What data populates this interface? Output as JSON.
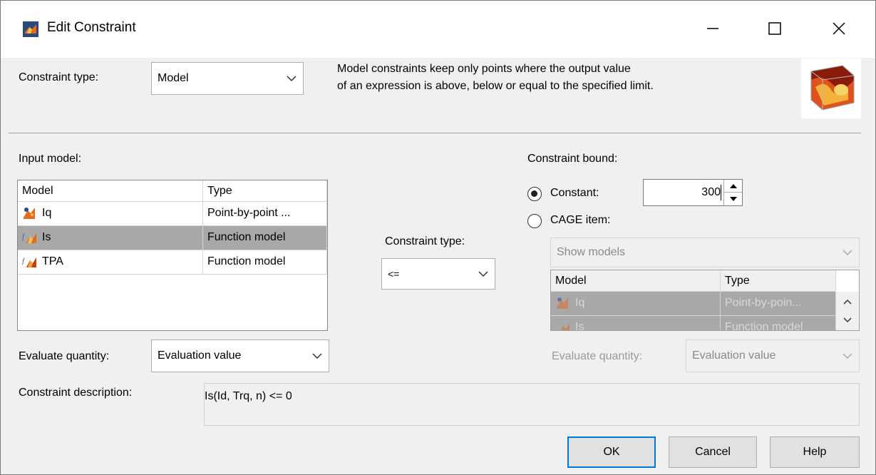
{
  "window": {
    "title": "Edit Constraint"
  },
  "header": {
    "constraint_type_label": "Constraint type:",
    "constraint_type_value": "Model",
    "description_line1": "Model constraints keep only points where the output value",
    "description_line2": "of an expression is above, below or equal to the specified limit."
  },
  "input_model": {
    "label": "Input model:",
    "columns": [
      "Model",
      "Type"
    ],
    "rows": [
      {
        "model": "Iq",
        "type": "Point-by-point ...",
        "icon": "point-by-point-model-icon"
      },
      {
        "model": "Is",
        "type": "Function model",
        "icon": "function-model-icon"
      },
      {
        "model": "TPA",
        "type": "Function model",
        "icon": "function-model-icon"
      }
    ],
    "selected_row": 1
  },
  "operator": {
    "label": "Constraint type:",
    "value": "<="
  },
  "bound": {
    "label": "Constraint bound:",
    "constant_label": "Constant:",
    "constant_value": "300",
    "constant_selected": true,
    "cage_label": "CAGE item:",
    "show_models_value": "Show models",
    "columns": [
      "Model",
      "Type"
    ],
    "rows": [
      {
        "model": "Iq",
        "type": "Point-by-poin..."
      },
      {
        "model": "Is",
        "type": "Function model"
      }
    ]
  },
  "evaluate_left": {
    "label": "Evaluate quantity:",
    "value": "Evaluation value"
  },
  "evaluate_right": {
    "label": "Evaluate quantity:",
    "value": "Evaluation value"
  },
  "description": {
    "label": "Constraint description:",
    "value": "Is(Id, Trq, n) <= 0"
  },
  "buttons": {
    "ok": "OK",
    "cancel": "Cancel",
    "help": "Help"
  },
  "colors": {
    "selection": "#a8a8a8",
    "default_button_border": "#0078d7",
    "window_bg": "#f0f0f0"
  }
}
